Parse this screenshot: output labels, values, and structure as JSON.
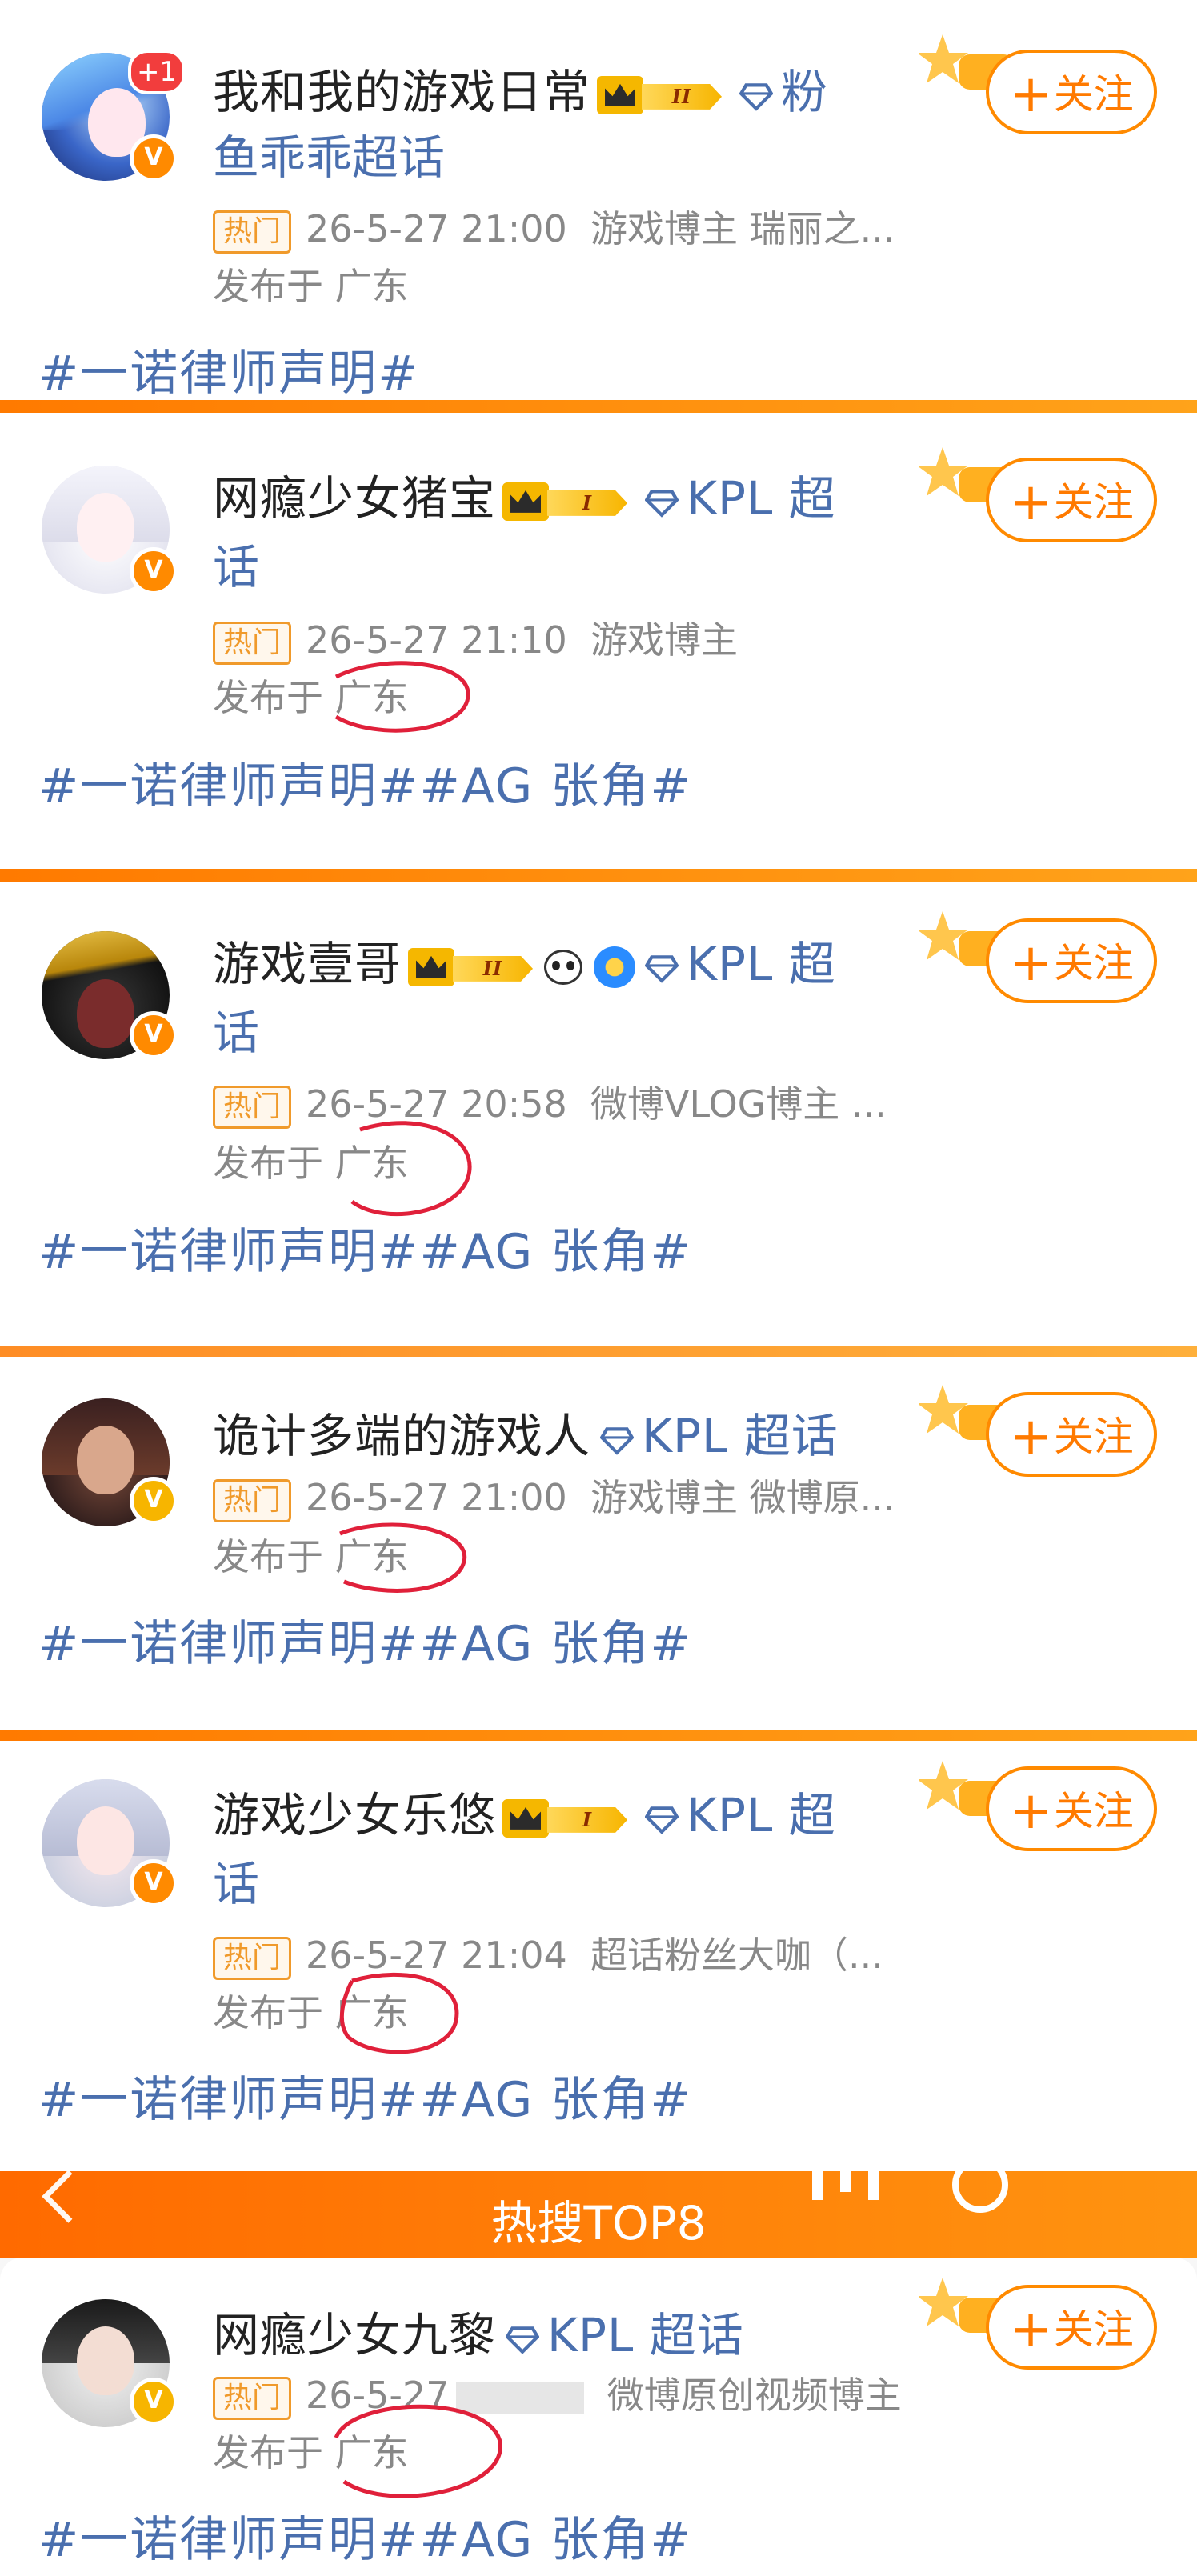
{
  "posts": [
    {
      "username": "我和我的游戏日常",
      "username_line2": "鱼乖乖超话",
      "vip_level": "II",
      "supertopic": "粉",
      "notification": "+1",
      "hot_label": "热门",
      "time": "26-5-27 21:00",
      "author_tag": "游戏博主 瑞丽之...",
      "location": "发布于 广东",
      "tags": "#一诺律师声明#",
      "follow_label": "关注"
    },
    {
      "username": "网瘾少女猪宝",
      "username_line2": "话",
      "vip_level": "I",
      "supertopic": "KPL 超",
      "hot_label": "热门",
      "time": "26-5-27 21:10",
      "author_tag": "游戏博主",
      "location": "发布于 广东",
      "tags": "#一诺律师声明##AG 张角#",
      "follow_label": "关注"
    },
    {
      "username": "游戏壹哥",
      "username_line2": "话",
      "vip_level": "II",
      "supertopic": "KPL 超",
      "hot_label": "热门",
      "time": "26-5-27 20:58",
      "author_tag": "微博VLOG博主 ...",
      "location": "发布于 广东",
      "tags": "#一诺律师声明##AG 张角#",
      "follow_label": "关注"
    },
    {
      "username": "诡计多端的游戏人",
      "supertopic": "KPL 超话",
      "hot_label": "热门",
      "time": "26-5-27 21:00",
      "author_tag": "游戏博主 微博原...",
      "location": "发布于 广东",
      "tags": "#一诺律师声明##AG 张角#",
      "follow_label": "关注"
    },
    {
      "username": "游戏少女乐悠",
      "username_line2": "话",
      "vip_level": "I",
      "supertopic": "KPL 超",
      "hot_label": "热门",
      "time": "26-5-27 21:04",
      "author_tag": "超话粉丝大咖（...",
      "location": "发布于 广东",
      "tags": "#一诺律师声明##AG 张角#",
      "follow_label": "关注"
    },
    {
      "username": "网瘾少女九黎",
      "supertopic": "KPL 超话",
      "hot_label": "热门",
      "time": "26-5-27",
      "author_tag": "微博原创视频博主",
      "location": "发布于 广东",
      "tags": "#一诺律师声明##AG 张角#",
      "follow_label": "关注"
    }
  ],
  "hotsearch": {
    "title": "热搜TOP8"
  },
  "colors": {
    "accent": "#ff8a00",
    "link": "#4a6fae",
    "annotation": "#e0203a"
  }
}
